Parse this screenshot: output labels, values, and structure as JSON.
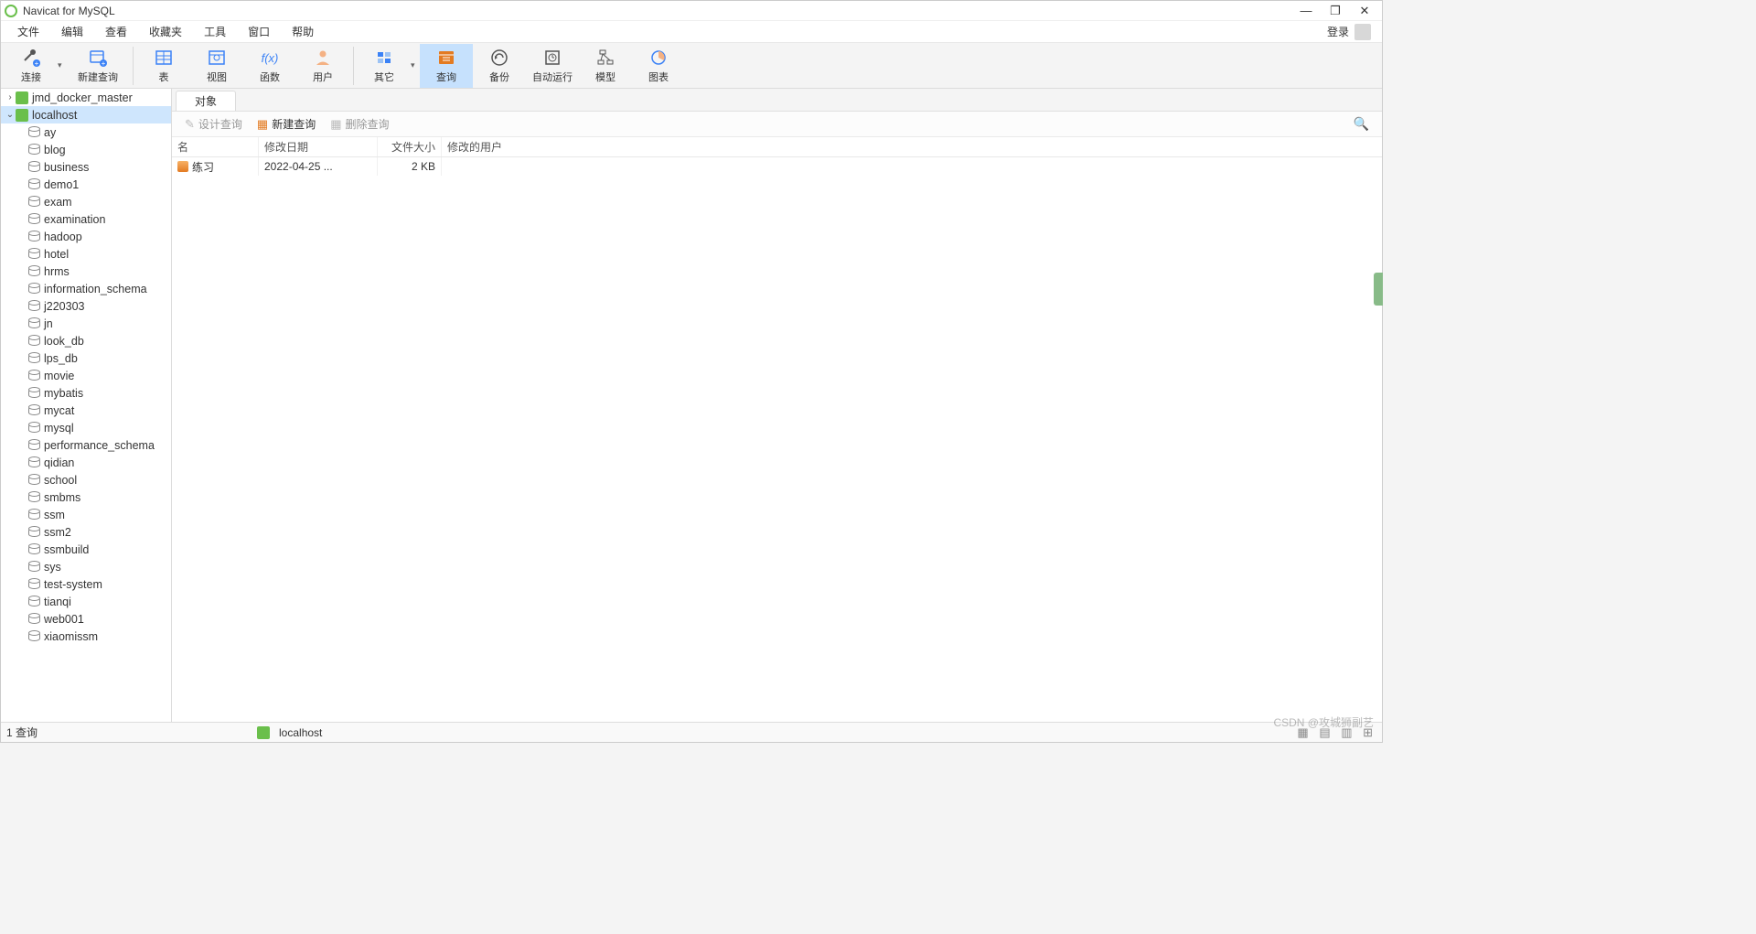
{
  "title": "Navicat for MySQL",
  "menubar": [
    "文件",
    "编辑",
    "查看",
    "收藏夹",
    "工具",
    "窗口",
    "帮助"
  ],
  "login_label": "登录",
  "toolbar": [
    {
      "id": "connect",
      "label": "连接",
      "dropdown": true
    },
    {
      "id": "newquery",
      "label": "新建查询"
    },
    {
      "sep": true
    },
    {
      "id": "table",
      "label": "表"
    },
    {
      "id": "view",
      "label": "视图"
    },
    {
      "id": "function",
      "label": "函数"
    },
    {
      "id": "user",
      "label": "用户"
    },
    {
      "sep": true
    },
    {
      "id": "other",
      "label": "其它",
      "dropdown": true
    },
    {
      "id": "query",
      "label": "查询",
      "active": true
    },
    {
      "id": "backup",
      "label": "备份"
    },
    {
      "id": "autorun",
      "label": "自动运行"
    },
    {
      "id": "model",
      "label": "模型"
    },
    {
      "id": "chart",
      "label": "图表"
    }
  ],
  "connections": [
    {
      "name": "jmd_docker_master",
      "expanded": false
    },
    {
      "name": "localhost",
      "expanded": true,
      "selected": true
    }
  ],
  "databases": [
    "ay",
    "blog",
    "business",
    "demo1",
    "exam",
    "examination",
    "hadoop",
    "hotel",
    "hrms",
    "information_schema",
    "j220303",
    "jn",
    "look_db",
    "lps_db",
    "movie",
    "mybatis",
    "mycat",
    "mysql",
    "performance_schema",
    "qidian",
    "school",
    "smbms",
    "ssm",
    "ssm2",
    "ssmbuild",
    "sys",
    "test-system",
    "tianqi",
    "web001",
    "xiaomissm"
  ],
  "tab_label": "对象",
  "subtoolbar": {
    "design": "设计查询",
    "new": "新建查询",
    "delete": "删除查询"
  },
  "columns": {
    "name": "名",
    "date": "修改日期",
    "size": "文件大小",
    "user": "修改的用户"
  },
  "rows": [
    {
      "name": "练习",
      "date": "2022-04-25 ...",
      "size": "2 KB",
      "user": ""
    }
  ],
  "statusbar": {
    "count": "1 查询",
    "conn": "localhost"
  },
  "watermark": "CSDN @攻城狮副艺"
}
